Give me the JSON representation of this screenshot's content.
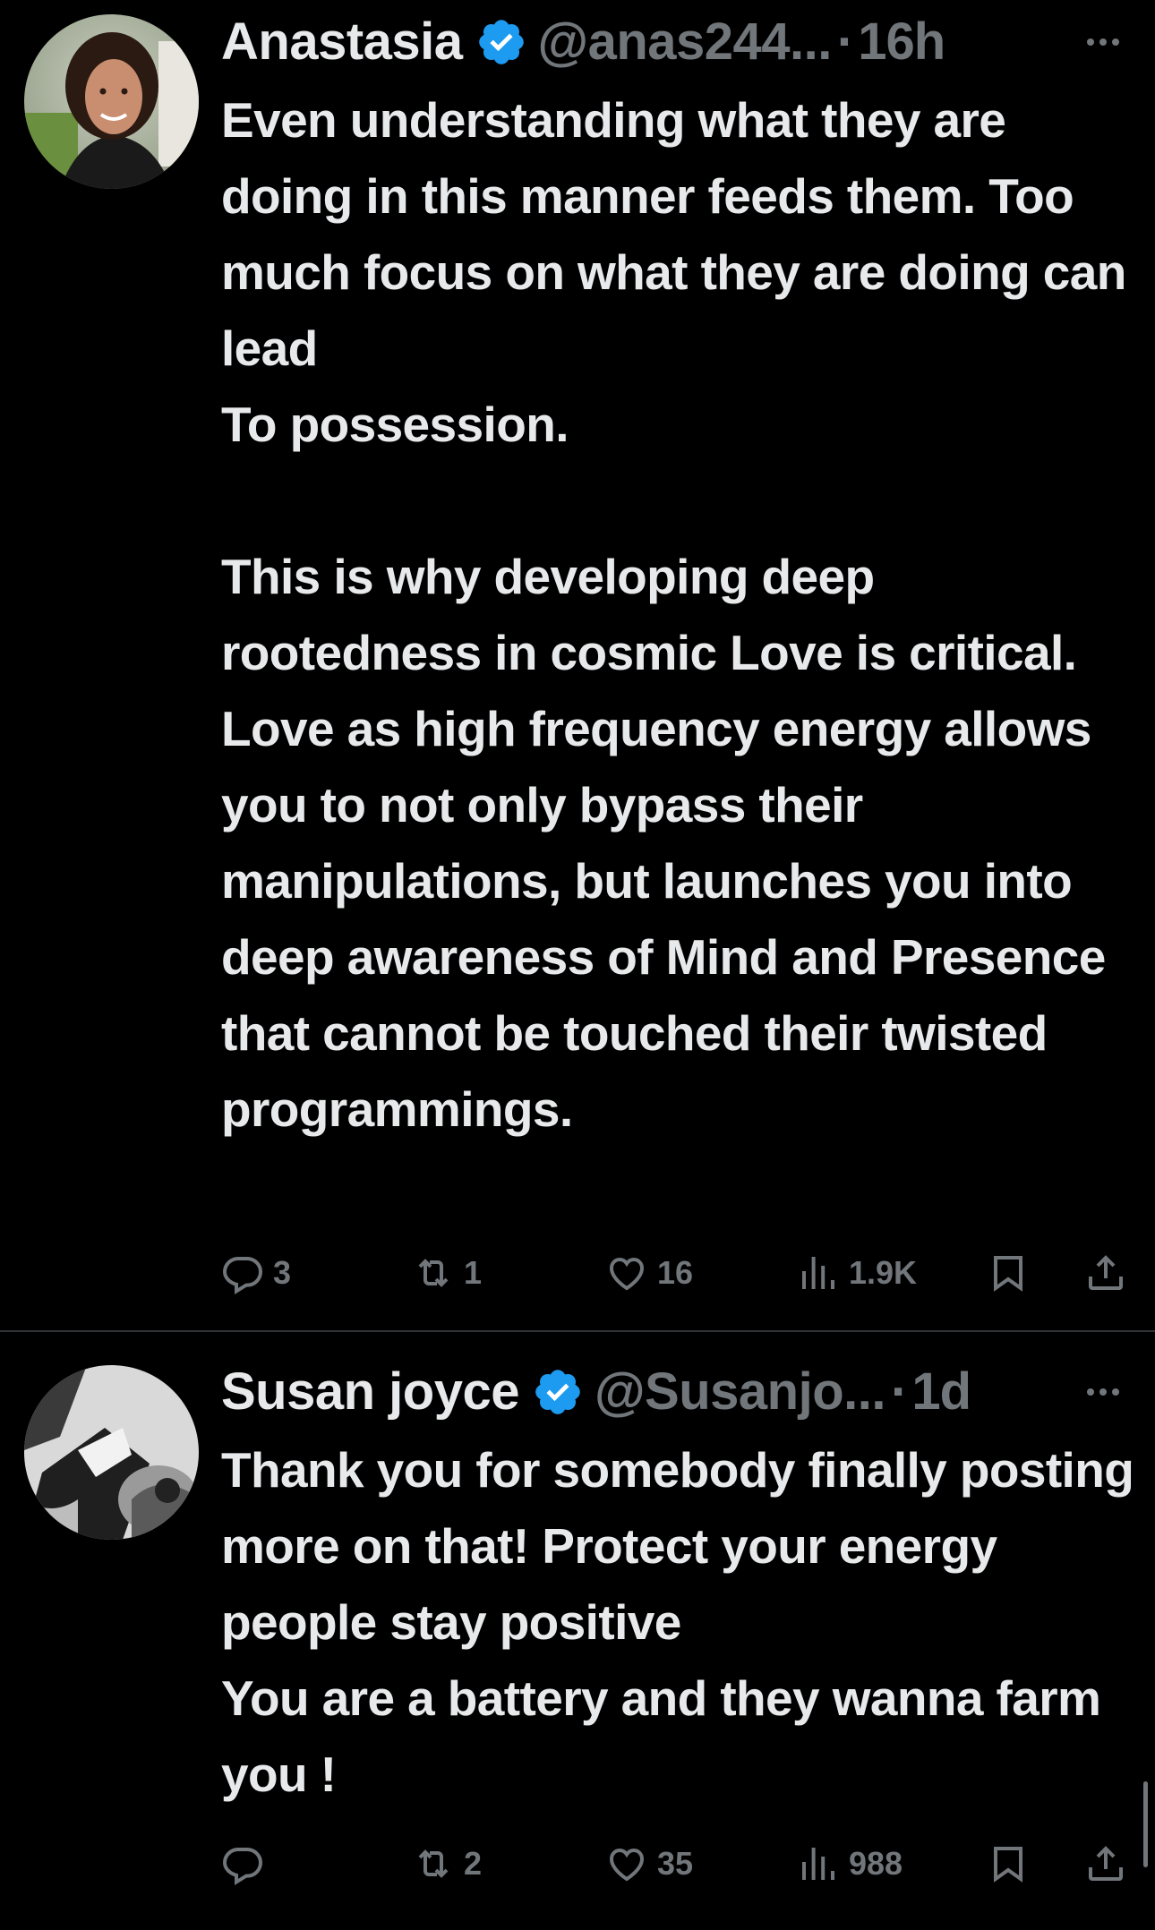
{
  "colors": {
    "background": "#000000",
    "text": "#e7e9ea",
    "muted": "#71767b",
    "verified": "#1d9bf0",
    "divider": "#2f3336"
  },
  "tweets": [
    {
      "display_name": "Anastasia",
      "verified_icon": "verified-badge-icon",
      "handle": "@anas244...",
      "separator": "·",
      "time": "16h",
      "paragraphs": [
        "Even understanding what they are doing in this manner feeds them. Too much focus on what they are doing can lead",
        "To possession.",
        "",
        "This is why developing deep rootedness in cosmic Love is critical. Love as high frequency energy allows you to not only bypass their manipulations, but launches you into deep awareness of Mind and Presence that cannot be touched their twisted programmings."
      ],
      "actions": {
        "reply_count": "3",
        "repost_count": "1",
        "like_count": "16",
        "view_count": "1.9K"
      }
    },
    {
      "display_name": "Susan joyce",
      "verified_icon": "verified-badge-icon",
      "handle": "@Susanjo...",
      "separator": "·",
      "time": "1d",
      "paragraphs": [
        "Thank you for somebody finally posting more on that! Protect your energy people stay positive",
        "You are a battery and they wanna farm you !"
      ],
      "actions": {
        "reply_count": "",
        "repost_count": "2",
        "like_count": "35",
        "view_count": "988"
      }
    }
  ]
}
